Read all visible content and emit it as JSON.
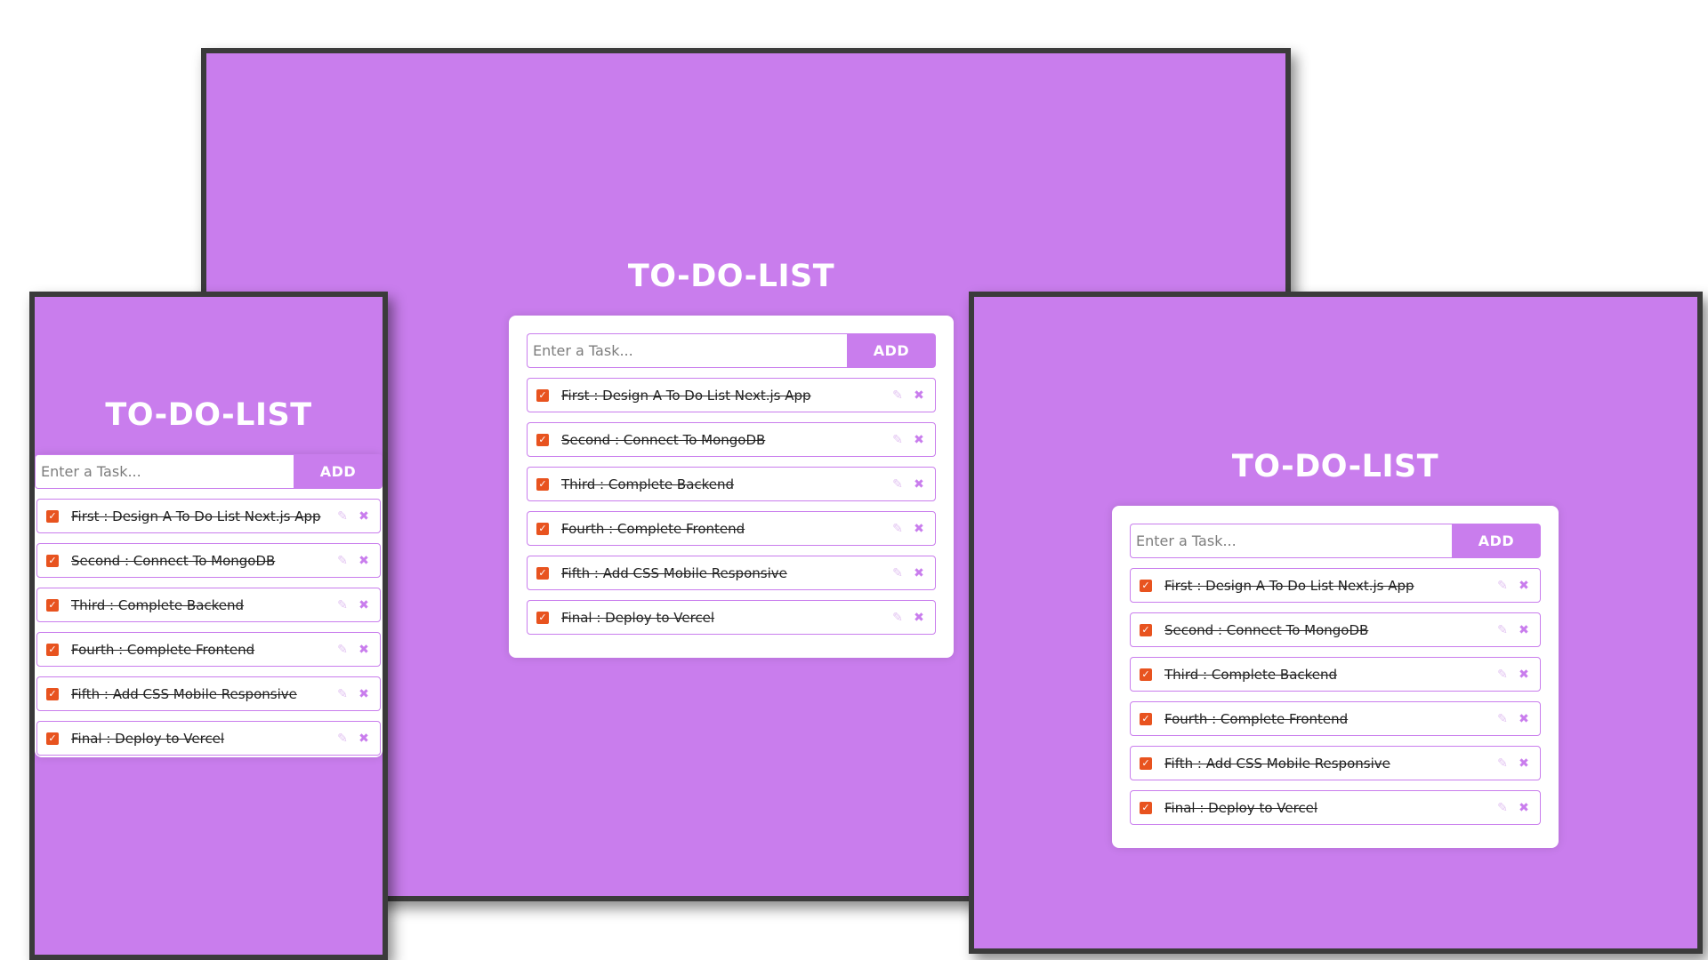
{
  "colors": {
    "primary": "#c97ded",
    "checkbox": "#e8531f",
    "frame_border": "#3b3b3b"
  },
  "icons": {
    "check": "checkmark-icon",
    "edit": "pencil-icon",
    "delete": "cross-icon"
  },
  "app": {
    "title": "TO-DO-LIST",
    "input_placeholder": "Enter a Task...",
    "add_label": "ADD",
    "edit_symbol": "✎",
    "delete_symbol": "✖",
    "tasks": [
      {
        "text": "First : Design A To Do List Next.js App",
        "completed": true
      },
      {
        "text": "Second : Connect To MongoDB",
        "completed": true
      },
      {
        "text": "Third : Complete Backend",
        "completed": true
      },
      {
        "text": "Fourth : Complete Frontend",
        "completed": true
      },
      {
        "text": "Fifth : Add CSS Mobile Responsive",
        "completed": true
      },
      {
        "text": "Final : Deploy to Vercel",
        "completed": true
      }
    ]
  }
}
